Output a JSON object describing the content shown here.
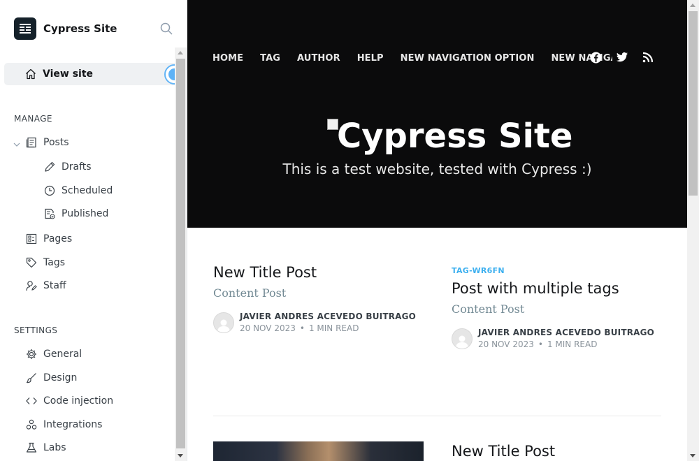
{
  "sidebar": {
    "brand": "Cypress Site",
    "view_site": "View site",
    "manage_title": "MANAGE",
    "settings_title": "SETTINGS",
    "items": [
      {
        "label": "Posts",
        "icon": "posts-icon"
      },
      {
        "label": "Drafts",
        "icon": "pencil-icon"
      },
      {
        "label": "Scheduled",
        "icon": "clock-icon"
      },
      {
        "label": "Published",
        "icon": "published-icon"
      },
      {
        "label": "Pages",
        "icon": "pages-icon"
      },
      {
        "label": "Tags",
        "icon": "tag-icon"
      },
      {
        "label": "Staff",
        "icon": "staff-icon"
      }
    ],
    "settings": [
      {
        "label": "General",
        "icon": "gear-icon"
      },
      {
        "label": "Design",
        "icon": "brush-icon"
      },
      {
        "label": "Code injection",
        "icon": "code-icon"
      },
      {
        "label": "Integrations",
        "icon": "integrations-icon"
      },
      {
        "label": "Labs",
        "icon": "flask-icon"
      }
    ]
  },
  "site": {
    "nav": [
      "HOME",
      "TAG",
      "AUTHOR",
      "HELP",
      "NEW NAVIGATION OPTION",
      "NEW NAVIGATI"
    ],
    "social": [
      "facebook-icon",
      "twitter-icon",
      "rss-icon"
    ],
    "title": "Cypress Site",
    "description": "This is a test website, tested with Cypress :)"
  },
  "posts": [
    {
      "tag": "",
      "title": "New Title Post",
      "excerpt": "Content Post",
      "author": "JAVIER ANDRES ACEVEDO BUITRAGO",
      "date": "20 NOV 2023",
      "read": "1 MIN READ"
    },
    {
      "tag": "TAG-WR6FN",
      "title": "Post with multiple tags",
      "excerpt": "Content Post",
      "author": "JAVIER ANDRES ACEVEDO BUITRAGO",
      "date": "20 NOV 2023",
      "read": "1 MIN READ"
    },
    {
      "tag": "",
      "title": "New Title Post"
    }
  ],
  "colors": {
    "hero_bg": "#0b0b0c",
    "tag_accent": "#3eb0ef",
    "sidebar_active_bg": "#eff1f3"
  }
}
